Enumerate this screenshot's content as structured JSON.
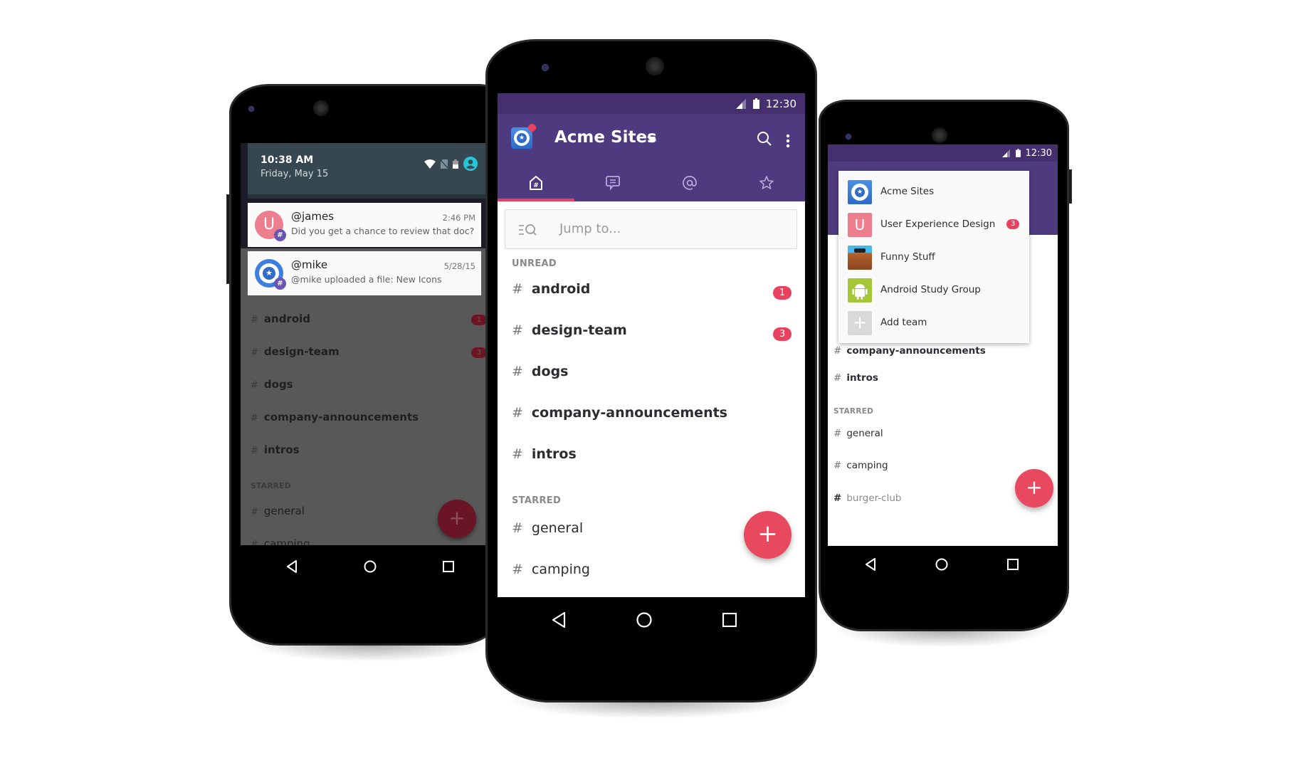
{
  "colors": {
    "brand_purple": "#4d3a7f",
    "status_purple": "#452f6e",
    "accent_red": "#e8425f",
    "notification_header": "#37474f"
  },
  "left_phone": {
    "notification_shade": {
      "time": "10:38 AM",
      "date": "Friday, May 15",
      "icons": [
        "wifi-icon",
        "no-sim-icon",
        "battery-icon",
        "account-icon"
      ]
    },
    "notifications": [
      {
        "avatar_letter": "U",
        "sender": "@james",
        "message": "Did you get a chance to review that doc?",
        "time": "2:46 PM"
      },
      {
        "avatar_letter": "",
        "sender": "@mike",
        "message": "@mike uploaded a file: New Icons",
        "time": "5/28/15"
      }
    ],
    "channels": [
      {
        "name": "android",
        "badge": "1"
      },
      {
        "name": "design-team",
        "badge": "3"
      },
      {
        "name": "dogs",
        "badge": ""
      },
      {
        "name": "company-announcements",
        "badge": ""
      },
      {
        "name": "intros",
        "badge": ""
      }
    ],
    "starred_label": "STARRED",
    "starred": [
      "general",
      "camping"
    ],
    "fab_label": "+"
  },
  "center_phone": {
    "status_time": "12:30",
    "team_name": "Acme Sites",
    "tabs": [
      {
        "name": "channels",
        "icon": "home-hash-icon",
        "active": true
      },
      {
        "name": "direct-messages",
        "icon": "chat-bubble-icon",
        "active": false
      },
      {
        "name": "mentions",
        "icon": "at-sign-icon",
        "active": false
      },
      {
        "name": "starred",
        "icon": "star-icon",
        "active": false
      }
    ],
    "search_placeholder": "Jump to...",
    "unread_label": "UNREAD",
    "unread": [
      {
        "name": "android",
        "badge": "1"
      },
      {
        "name": "design-team",
        "badge": "3"
      },
      {
        "name": "dogs",
        "badge": ""
      },
      {
        "name": "company-announcements",
        "badge": ""
      },
      {
        "name": "intros",
        "badge": ""
      }
    ],
    "starred_label": "STARRED",
    "starred": [
      "general",
      "camping"
    ],
    "fab_label": "+"
  },
  "right_phone": {
    "status_time": "12:30",
    "teams": [
      {
        "name": "Acme Sites",
        "tile": "acme-logo",
        "badge": ""
      },
      {
        "name": "User Experience Design",
        "tile": "U",
        "badge": "3"
      },
      {
        "name": "Funny Stuff",
        "tile": "photo",
        "badge": ""
      },
      {
        "name": "Android Study Group",
        "tile": "android-logo",
        "badge": ""
      },
      {
        "name": "Add team",
        "tile": "+",
        "badge": ""
      }
    ],
    "channels": [
      {
        "name": "company-announcements",
        "bold": true
      },
      {
        "name": "intros",
        "bold": true
      }
    ],
    "starred_label": "STARRED",
    "starred": [
      "general",
      "camping",
      "burger-club"
    ],
    "fab_label": "+"
  },
  "hash": "#"
}
